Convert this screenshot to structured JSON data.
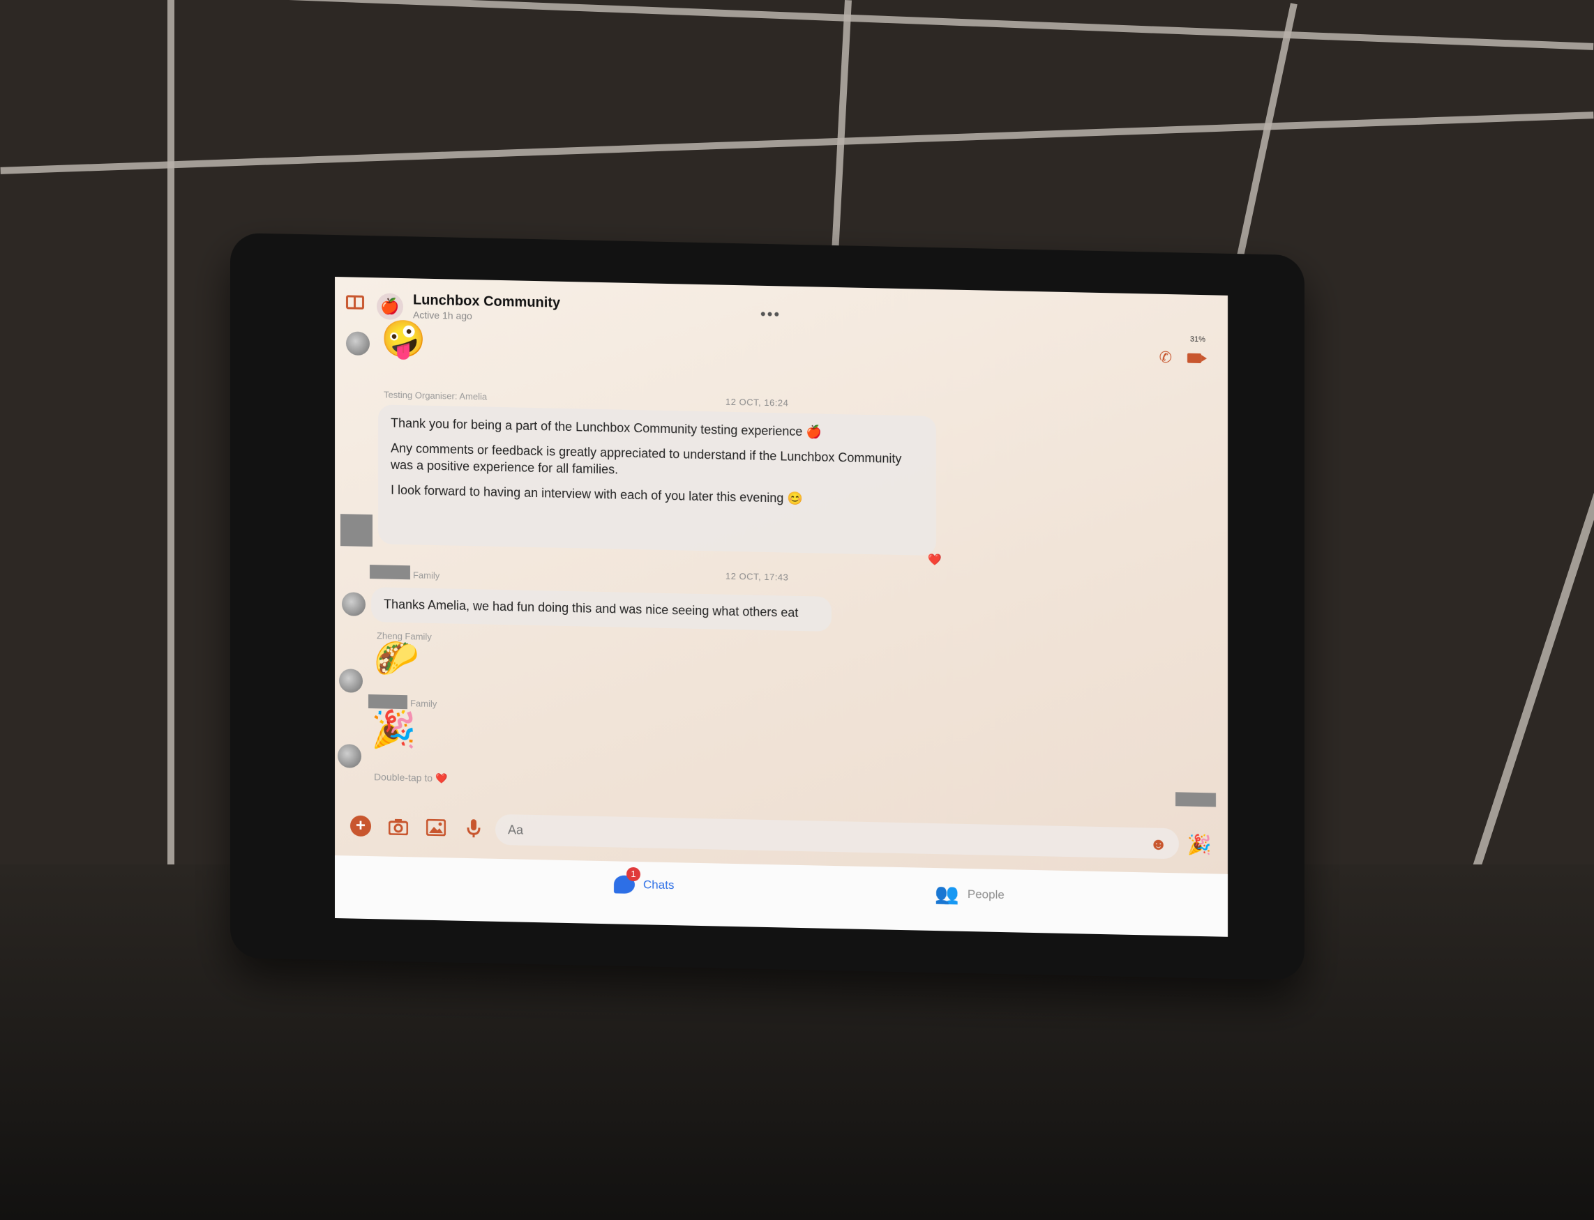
{
  "header": {
    "group_name": "Lunchbox Community",
    "group_status": "Active 1h ago",
    "more_label": "•••",
    "status_bar": "31%"
  },
  "messages": {
    "top_emoji": "🤪",
    "msg1": {
      "sender": "Testing Organiser: Amelia",
      "time": "12 OCT, 16:24",
      "line1": "Thank you for being a part of the Lunchbox Community testing experience 🍎",
      "line2": "Any comments or feedback is greatly appreciated to understand if the Lunchbox Community was a positive experience for all families.",
      "line3": "I look forward to having an interview with each of you later this evening 😊",
      "reaction": "❤️"
    },
    "msg2": {
      "sender_suffix": "Family",
      "time": "12 OCT, 17:43",
      "text": "Thanks Amelia, we had fun doing this and was nice seeing what others eat"
    },
    "msg3": {
      "sender": "Zheng Family",
      "emoji": "🌮"
    },
    "msg4": {
      "sender_suffix": "Family",
      "emoji": "🎉"
    },
    "hint": "Double-tap to ❤️"
  },
  "composer": {
    "placeholder": "Aa",
    "add_icon": "+",
    "emoji_icon": "☻",
    "party_icon": "🎉"
  },
  "tabs": {
    "chats_label": "Chats",
    "chats_badge": "1",
    "people_label": "People"
  },
  "colors": {
    "accent": "#c8562e",
    "active_tab": "#2d6fe6",
    "badge": "#e0393a"
  }
}
